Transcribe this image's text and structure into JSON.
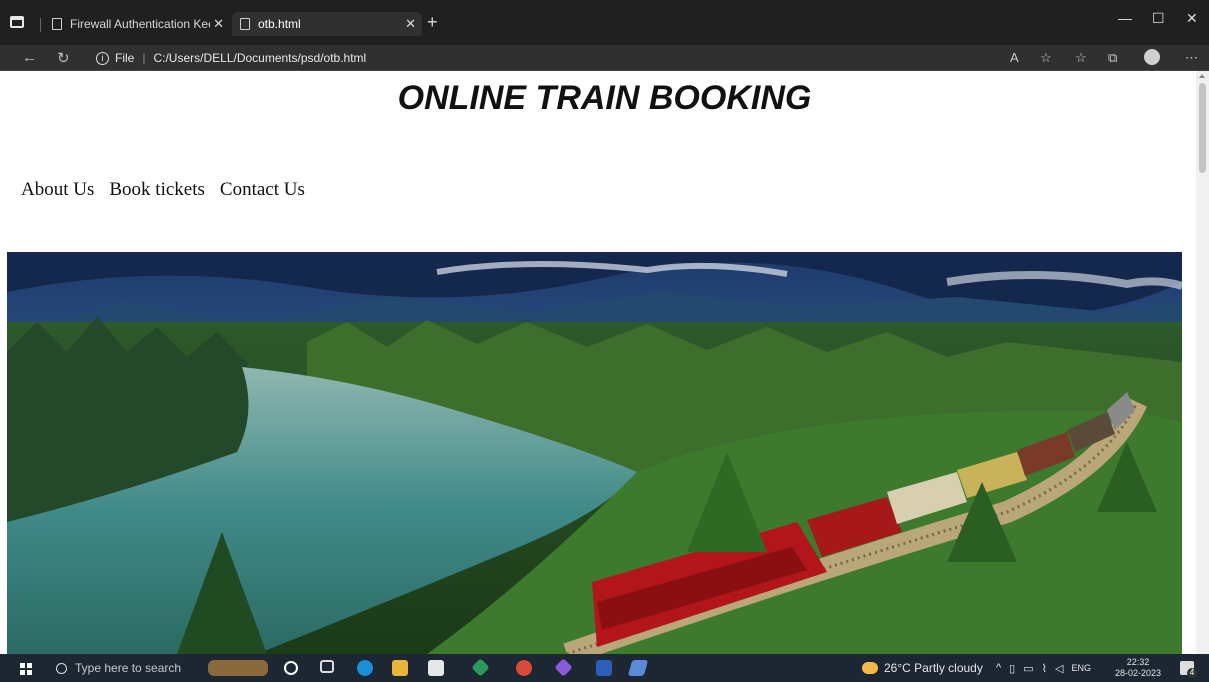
{
  "browser": {
    "tabs": [
      {
        "title": "Firewall Authentication Keepalive"
      },
      {
        "title": "otb.html"
      }
    ],
    "address": {
      "scheme_label": "File",
      "path": "C:/Users/DELL/Documents/psd/otb.html"
    }
  },
  "page": {
    "title": "ONLINE TRAIN BOOKING",
    "nav": [
      {
        "label": "About Us"
      },
      {
        "label": "Book tickets"
      },
      {
        "label": "Contact Us"
      }
    ]
  },
  "taskbar": {
    "search_placeholder": "Type here to search",
    "weather": "26°C  Partly cloudy",
    "language": "ENG",
    "time": "22:32",
    "date": "28-02-2023",
    "notification_count": "4"
  }
}
